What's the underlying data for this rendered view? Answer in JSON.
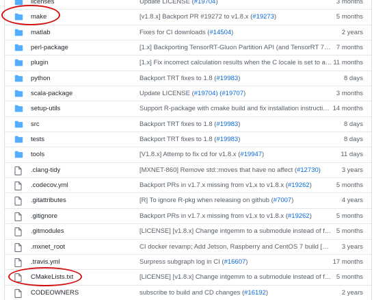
{
  "files": [
    {
      "type": "folder",
      "icon": "folder-icon",
      "name": "licenses",
      "message": "Update LICENSE",
      "link": "#19704",
      "age": "3 months"
    },
    {
      "type": "folder",
      "icon": "folder-icon",
      "name": "make",
      "message": "[v1.8.x] Backport PR #19272 to v1.8.x",
      "link": "#19273",
      "age": "5 months"
    },
    {
      "type": "folder",
      "icon": "folder-icon",
      "name": "matlab",
      "message": "Fixes for CI downloads",
      "link": "#14504",
      "age": "2 years"
    },
    {
      "type": "folder",
      "icon": "folder-icon",
      "name": "perl-package",
      "message": "[1.x] Backporting TensorRT-Gluon Partition API (and TensorRT 7 suppor…",
      "link": "",
      "age": "7 months"
    },
    {
      "type": "folder",
      "icon": "folder-icon",
      "name": "plugin",
      "message": "[1.x] Fix incorrect calculation results when the C locale is set to a…",
      "link": "",
      "age": "11 months"
    },
    {
      "type": "folder",
      "icon": "folder-icon",
      "name": "python",
      "message": "Backport TRT fixes to 1.8",
      "link": "#19983",
      "age": "8 days"
    },
    {
      "type": "folder",
      "icon": "folder-icon",
      "name": "scala-package",
      "message": "Update LICENSE",
      "link": "#19704) (#19707",
      "age": "3 months"
    },
    {
      "type": "folder",
      "icon": "folder-icon",
      "name": "setup-utils",
      "message": "Support R-package with cmake build and fix installation instructions",
      "link": "#…",
      "age": "14 months"
    },
    {
      "type": "folder",
      "icon": "folder-icon",
      "name": "src",
      "message": "Backport TRT fixes to 1.8",
      "link": "#19983",
      "age": "8 days"
    },
    {
      "type": "folder",
      "icon": "folder-icon",
      "name": "tests",
      "message": "Backport TRT fixes to 1.8",
      "link": "#19983",
      "age": "8 days"
    },
    {
      "type": "folder",
      "icon": "folder-icon",
      "name": "tools",
      "message": "[V1.8.x] Attemp to fix cd for v1.8.x",
      "link": "#19947",
      "age": "11 days"
    },
    {
      "type": "file",
      "icon": "file-icon",
      "name": ".clang-tidy",
      "message": "[MXNET-860] Remove std::moves that have no affect",
      "link": "#12730",
      "age": "3 years"
    },
    {
      "type": "file",
      "icon": "file-icon",
      "name": ".codecov.yml",
      "message": "Backport PRs in v1.7.x missing from v1.x to v1.8.x",
      "link": "#19262",
      "age": "5 months"
    },
    {
      "type": "file",
      "icon": "file-icon",
      "name": ".gitattributes",
      "message": "[R] To ignore R-pkg when releasing on github",
      "link": "#7007",
      "age": "4 years"
    },
    {
      "type": "file",
      "icon": "file-icon",
      "name": ".gitignore",
      "message": "Backport PRs in v1.7.x missing from v1.x to v1.8.x",
      "link": "#19262",
      "age": "5 months"
    },
    {
      "type": "file",
      "icon": "file-icon",
      "name": ".gitmodules",
      "message": "[LICENSE] [v1.8.x] Change intgemm to a submodule instead of fetch.",
      "link": "#…",
      "age": "5 months"
    },
    {
      "type": "file",
      "icon": "file-icon",
      "name": ".mxnet_root",
      "message": "CI docker revamp; Add Jetson, Raspberry and CentOS 7 build [MXNET-42…",
      "link": "",
      "age": "3 years"
    },
    {
      "type": "file",
      "icon": "file-icon",
      "name": ".travis.yml",
      "message": "Surpress subgraph log in CI",
      "link": "#16607",
      "age": "17 months"
    },
    {
      "type": "file",
      "icon": "file-icon",
      "name": "CMakeLists.txt",
      "message": "[LICENSE] [v1.8.x] Change intgemm to a submodule instead of fetch.",
      "link": "#…",
      "age": "5 months"
    },
    {
      "type": "file",
      "icon": "file-icon",
      "name": "CODEOWNERS",
      "message": "subscribe to build and CD changes",
      "link": "#16192",
      "age": "2 years"
    }
  ],
  "colors": {
    "folder": "#54aeff",
    "file_stroke": "#57606a",
    "link": "#0969da",
    "annotation": "#d31111"
  },
  "annotations": [
    {
      "name": "make-highlight-ellipse",
      "target": "make"
    },
    {
      "name": "cmakelists-highlight-ellipse",
      "target": "CMakeLists.txt"
    }
  ]
}
